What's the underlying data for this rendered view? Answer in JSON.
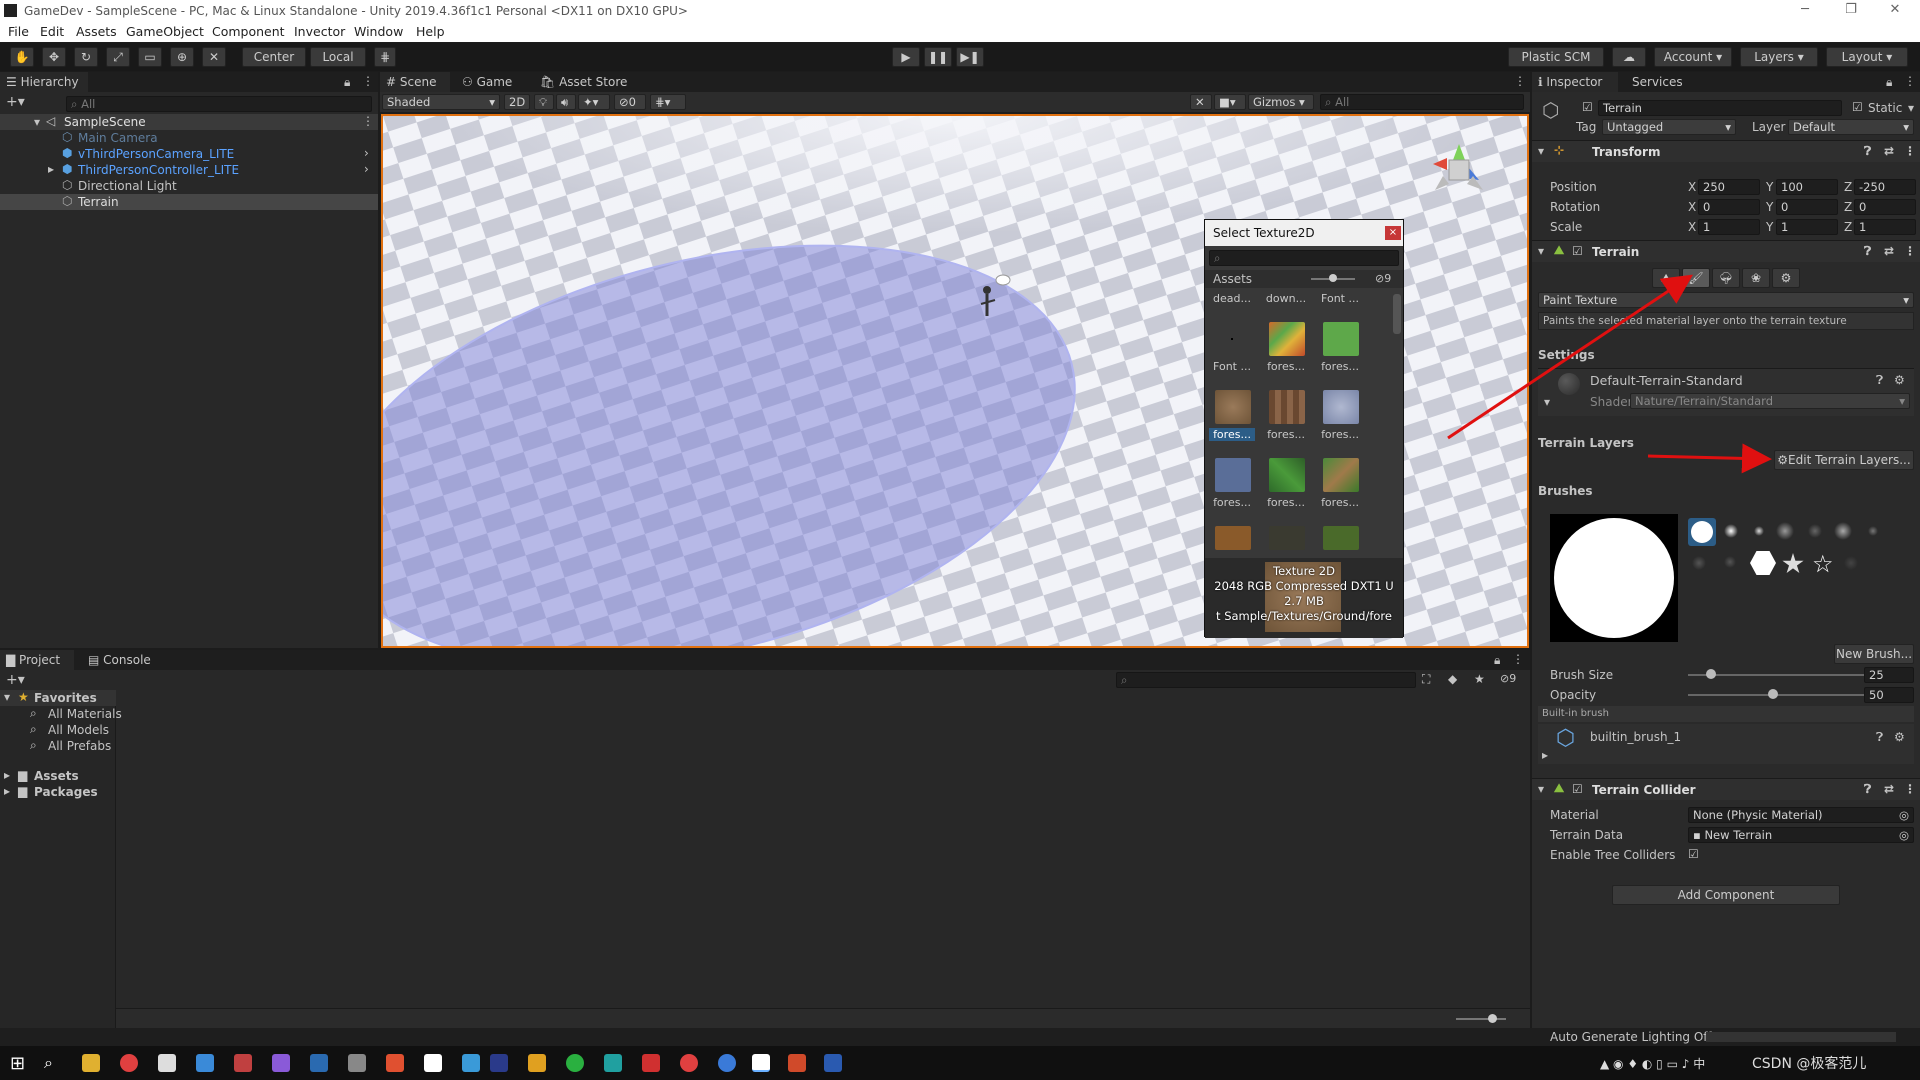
{
  "window": {
    "title": "GameDev - SampleScene - PC, Mac & Linux Standalone - Unity 2019.4.36f1c1 Personal <DX11 on DX10 GPU>"
  },
  "menu": [
    "File",
    "Edit",
    "Assets",
    "GameObject",
    "Component",
    "Invector",
    "Window",
    "Help"
  ],
  "toolbar": {
    "center": "Center",
    "local": "Local",
    "plastic": "Plastic SCM",
    "account": "Account",
    "layers": "Layers",
    "layout": "Layout"
  },
  "hierarchy": {
    "tab": "Hierarchy",
    "search": "All",
    "scene": "SampleScene",
    "items": [
      "Main Camera",
      "vThirdPersonCamera_LITE",
      "ThirdPersonController_LITE",
      "Directional Light",
      "Terrain"
    ]
  },
  "scene": {
    "tabs": [
      "Scene",
      "Game",
      "Asset Store"
    ],
    "shading": "Shaded",
    "mode2d": "2D",
    "fx_count": "0",
    "gizmos": "Gizmos",
    "search": "All"
  },
  "picker": {
    "title": "Select Texture2D",
    "close": "×",
    "section": "Assets",
    "count": "9",
    "top_labels": [
      "dead...",
      "down...",
      "Font ..."
    ],
    "rows": [
      [
        "Font ...",
        "fores...",
        "fores..."
      ],
      [
        "fores...",
        "fores...",
        "fores..."
      ],
      [
        "fores...",
        "fores...",
        "fores..."
      ]
    ],
    "info": [
      "Texture 2D",
      "2048  RGB Compressed DXT1 U",
      "2.7 MB",
      "t Sample/Textures/Ground/fore"
    ]
  },
  "project": {
    "tabs": [
      "Project",
      "Console"
    ],
    "favorites": "Favorites",
    "fav_items": [
      "All Materials",
      "All Models",
      "All Prefabs"
    ],
    "roots": [
      "Assets",
      "Packages"
    ],
    "count": "9"
  },
  "inspector": {
    "tabs": [
      "Inspector",
      "Services"
    ],
    "object_name": "Terrain",
    "static": "Static",
    "tag_label": "Tag",
    "tag": "Untagged",
    "layer_label": "Layer",
    "layer": "Default",
    "transform": {
      "title": "Transform",
      "rows": [
        {
          "label": "Position",
          "x": "250",
          "y": "100",
          "z": "-250"
        },
        {
          "label": "Rotation",
          "x": "0",
          "y": "0",
          "z": "0"
        },
        {
          "label": "Scale",
          "x": "1",
          "y": "1",
          "z": "1"
        }
      ]
    },
    "terrain": {
      "title": "Terrain",
      "tool": "Paint Texture",
      "desc": "Paints the selected material layer onto the terrain texture",
      "settings": "Settings",
      "material": "Default-Terrain-Standard",
      "shader_label": "Shader",
      "shader": "Nature/Terrain/Standard",
      "layers_label": "Terrain Layers",
      "edit_layers": "Edit Terrain Layers...",
      "brushes": "Brushes",
      "new_brush": "New Brush...",
      "brush_size_label": "Brush Size",
      "brush_size": "25",
      "opacity_label": "Opacity",
      "opacity": "50",
      "builtin": "Built-in brush",
      "brush_name": "builtin_brush_1"
    },
    "collider": {
      "title": "Terrain Collider",
      "material_label": "Material",
      "material": "None (Physic Material)",
      "data_label": "Terrain Data",
      "data": "New Terrain",
      "trees_label": "Enable Tree Colliders"
    },
    "add_component": "Add Component"
  },
  "status": {
    "lighting": "Auto Generate Lighting Off"
  },
  "taskbar": {
    "watermark": "CSDN @极客范儿"
  },
  "colors": {
    "accent": "#3a72b0",
    "arrow": "#e01010",
    "selection": "#2c5d87"
  }
}
